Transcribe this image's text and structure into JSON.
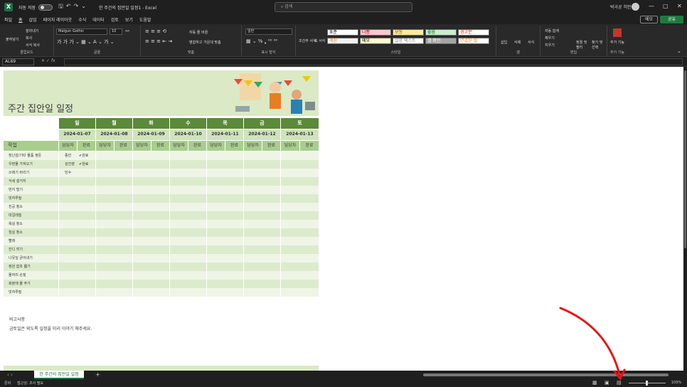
{
  "titlebar": {
    "autosave_label": "자동 저장",
    "autosave_state": "끔",
    "doc_title": "한 주간의 집안일 일정1 - Excel",
    "search_placeholder": "검색",
    "user_name": "박극공 허안",
    "minimize": "—",
    "maximize": "▢",
    "close": "✕"
  },
  "menu": {
    "items": [
      "파일",
      "홈",
      "삽입",
      "페이지 레이아웃",
      "수식",
      "데이터",
      "검토",
      "보기",
      "도움말"
    ],
    "memo_label": "메모",
    "share_label": "공유"
  },
  "ribbon": {
    "clipboard": {
      "label": "클립보드",
      "paste": "붙여넣기",
      "cut": "잘라내기",
      "copy": "복사",
      "format_painter": "서식 복사"
    },
    "font": {
      "label": "글꼴",
      "font_name": "Malgun Gothic",
      "font_size": "10"
    },
    "alignment": {
      "label": "맞춤",
      "wrap": "자동 줄 바꿈",
      "merge": "병합하고 가운데 맞춤"
    },
    "number": {
      "label": "표시 형식",
      "format": "일반"
    },
    "styles": {
      "label": "스타일",
      "conditional": "조건부 서식",
      "table": "표 서식",
      "items": [
        {
          "text": "표준",
          "color": "#ffffff",
          "fg": "#000000"
        },
        {
          "text": "나쁨",
          "color": "#ffc7ce",
          "fg": "#9c0006"
        },
        {
          "text": "보통",
          "color": "#ffeb9c",
          "fg": "#9c5700"
        },
        {
          "text": "좋음",
          "color": "#c6efce",
          "fg": "#006100"
        },
        {
          "text": "경고문",
          "color": "#ffffff",
          "fg": "#ff0000"
        },
        {
          "text": "계산",
          "color": "#f2f2f2",
          "fg": "#fa7d00"
        },
        {
          "text": "메모",
          "color": "#ffffcc",
          "fg": "#000000"
        },
        {
          "text": "설명 텍스트",
          "color": "#ffffff",
          "fg": "#7f7f7f"
        },
        {
          "text": "셀 확인",
          "color": "#a5a5a5",
          "fg": "#ffffff"
        },
        {
          "text": "연결된 셀",
          "color": "#ffffff",
          "fg": "#fa7d00"
        }
      ]
    },
    "cells": {
      "label": "셀",
      "insert": "삽입",
      "delete": "삭제",
      "format": "서식"
    },
    "editing": {
      "label": "편집",
      "autosum": "자동 합계",
      "fill": "채우기",
      "clear": "지우기",
      "sort": "정렬 및 필터",
      "find": "찾기 및 선택"
    },
    "addins": {
      "label": "추가 기능",
      "btn": "추가 기능"
    }
  },
  "formula_bar": {
    "name_box": "AL69",
    "fx": "fx"
  },
  "sheet": {
    "title": "주간 집안일 일정",
    "days": [
      "일",
      "월",
      "화",
      "수",
      "목",
      "금",
      "토"
    ],
    "dates": [
      "2024-01-07",
      "2024-01-08",
      "2024-01-09",
      "2024-01-10",
      "2024-01-11",
      "2024-01-12",
      "2024-01-13"
    ],
    "task_header": "작업",
    "owner_header": "담당자",
    "done_header": "완료",
    "tasks": [
      {
        "name": "장난감/기타 물품 정돈",
        "owner": "종민",
        "done": "✔완료"
      },
      {
        "name": "우편물 가져오기",
        "owner": "김진영",
        "done": "✔완료"
      },
      {
        "name": "쓰레기 버리기",
        "owner": "민수",
        "done": ""
      },
      {
        "name": "식세 설거지",
        "owner": "",
        "done": ""
      },
      {
        "name": "먼지 털기",
        "owner": "",
        "done": ""
      },
      {
        "name": "빗자루질",
        "owner": "",
        "done": ""
      },
      {
        "name": "진공 청소",
        "owner": "",
        "done": ""
      },
      {
        "name": "대걸레질",
        "owner": "",
        "done": ""
      },
      {
        "name": "욕실 청소",
        "owner": "",
        "done": ""
      },
      {
        "name": "침실 청소",
        "owner": "",
        "done": ""
      },
      {
        "name": "빨래",
        "owner": "",
        "done": ""
      },
      {
        "name": "잔디 깎기",
        "owner": "",
        "done": ""
      },
      {
        "name": "나뭇잎 긁어내기",
        "owner": "",
        "done": ""
      },
      {
        "name": "정원 잡초 뽑기",
        "owner": "",
        "done": ""
      },
      {
        "name": "물자리 손질",
        "owner": "",
        "done": ""
      },
      {
        "name": "화분에 물 주기",
        "owner": "",
        "done": ""
      },
      {
        "name": "빗자루질",
        "owner": "",
        "done": ""
      }
    ],
    "notes_title": "비고사항",
    "notes_text": "금토일은 외도록 일정을 미리 이야기 해주세요."
  },
  "tabs": {
    "sheet_name": "한 주간의 집안일 일정",
    "add": "+"
  },
  "status": {
    "ready": "준비",
    "accessibility": "접근성: 조사 필요",
    "zoom": "100%"
  }
}
